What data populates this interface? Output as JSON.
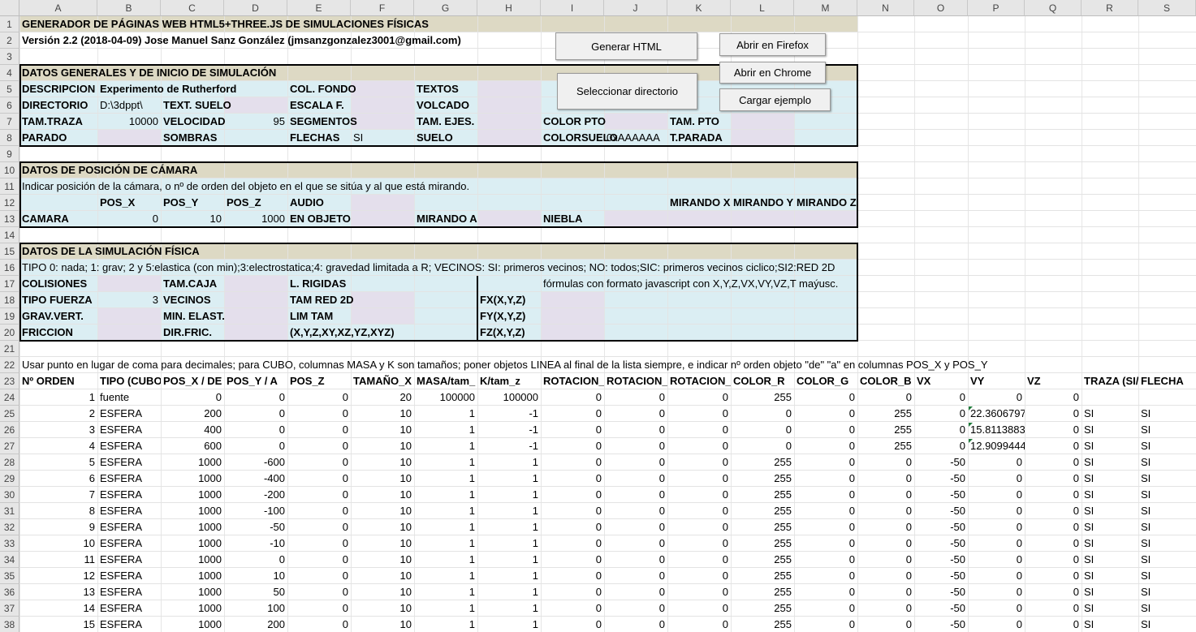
{
  "columns": [
    "A",
    "B",
    "C",
    "D",
    "E",
    "F",
    "G",
    "H",
    "I",
    "J",
    "K",
    "L",
    "M",
    "N",
    "O",
    "P",
    "Q",
    "R",
    "S"
  ],
  "rows": [
    "1",
    "2",
    "3",
    "4",
    "5",
    "6",
    "7",
    "8",
    "9",
    "10",
    "11",
    "12",
    "13",
    "14",
    "15",
    "16",
    "17",
    "18",
    "19",
    "20",
    "21",
    "22",
    "23",
    "24",
    "25",
    "26",
    "27",
    "28",
    "29",
    "30",
    "31",
    "32",
    "33",
    "34",
    "35",
    "36",
    "37",
    "38"
  ],
  "buttons": {
    "generate": "Generar HTML",
    "select_dir": "Seleccionar directorio",
    "firefox": "Abrir en Firefox",
    "chrome": "Abrir en Chrome",
    "load_example": "Cargar ejemplo"
  },
  "colors": {
    "header_band": "#ddd9c4",
    "section_bg": "#dbeef3",
    "input_cell": "#e4dfec"
  },
  "cells": [
    {
      "r": 1,
      "c": "A",
      "v": "GENERADOR DE PÁGINAS WEB HTML5+THREE.JS DE SIMULACIONES FÍSICAS",
      "b": 1
    },
    {
      "r": 2,
      "c": "A",
      "v": "Versión 2.2 (2018-04-09) Jose Manuel Sanz González (jmsanzgonzalez3001@gmail.com)",
      "b": 1
    },
    {
      "r": 4,
      "c": "A",
      "v": "DATOS GENERALES Y DE INICIO DE SIMULACIÓN",
      "b": 1
    },
    {
      "r": 5,
      "c": "A",
      "v": "DESCRIPCION",
      "b": 1
    },
    {
      "r": 5,
      "c": "B",
      "v": "Experimento de Rutherford",
      "b": 1
    },
    {
      "r": 5,
      "c": "E",
      "v": "COL. FONDO",
      "b": 1
    },
    {
      "r": 5,
      "c": "G",
      "v": "TEXTOS",
      "b": 1
    },
    {
      "r": 6,
      "c": "A",
      "v": "DIRECTORIO",
      "b": 1
    },
    {
      "r": 6,
      "c": "B",
      "v": "D:\\3dppt\\"
    },
    {
      "r": 6,
      "c": "C",
      "v": "TEXT. SUELO",
      "b": 1
    },
    {
      "r": 6,
      "c": "E",
      "v": "ESCALA F.",
      "b": 1
    },
    {
      "r": 6,
      "c": "G",
      "v": "VOLCADO",
      "b": 1
    },
    {
      "r": 7,
      "c": "A",
      "v": "TAM.TRAZA",
      "b": 1
    },
    {
      "r": 7,
      "c": "B",
      "v": "10000",
      "a": "r"
    },
    {
      "r": 7,
      "c": "C",
      "v": "VELOCIDAD",
      "b": 1
    },
    {
      "r": 7,
      "c": "D",
      "v": "95",
      "a": "r"
    },
    {
      "r": 7,
      "c": "E",
      "v": "SEGMENTOS",
      "b": 1
    },
    {
      "r": 7,
      "c": "G",
      "v": "TAM. EJES.",
      "b": 1
    },
    {
      "r": 7,
      "c": "I",
      "v": "COLOR PTO",
      "b": 1
    },
    {
      "r": 7,
      "c": "K",
      "v": "TAM. PTO",
      "b": 1
    },
    {
      "r": 8,
      "c": "A",
      "v": "PARADO",
      "b": 1
    },
    {
      "r": 8,
      "c": "C",
      "v": "SOMBRAS",
      "b": 1
    },
    {
      "r": 8,
      "c": "E",
      "v": "FLECHAS",
      "b": 1
    },
    {
      "r": 8,
      "c": "F",
      "v": "SI"
    },
    {
      "r": 8,
      "c": "G",
      "v": "SUELO",
      "b": 1
    },
    {
      "r": 8,
      "c": "I",
      "v": "COLORSUELO",
      "b": 1
    },
    {
      "r": 8,
      "c": "J",
      "v": "0xAAAAAA"
    },
    {
      "r": 8,
      "c": "K",
      "v": "T.PARADA",
      "b": 1
    },
    {
      "r": 10,
      "c": "A",
      "v": "DATOS DE POSICIÓN DE CÁMARA",
      "b": 1
    },
    {
      "r": 11,
      "c": "A",
      "v": "Indicar posición de la cámara, o nº de orden del objeto en el que se sitúa y al que está mirando."
    },
    {
      "r": 12,
      "c": "B",
      "v": "POS_X",
      "b": 1
    },
    {
      "r": 12,
      "c": "C",
      "v": "POS_Y",
      "b": 1
    },
    {
      "r": 12,
      "c": "D",
      "v": "POS_Z",
      "b": 1
    },
    {
      "r": 12,
      "c": "E",
      "v": "AUDIO",
      "b": 1
    },
    {
      "r": 12,
      "c": "K",
      "v": "MIRANDO X",
      "b": 1
    },
    {
      "r": 12,
      "c": "L",
      "v": "MIRANDO Y",
      "b": 1
    },
    {
      "r": 12,
      "c": "M",
      "v": "MIRANDO Z",
      "b": 1
    },
    {
      "r": 13,
      "c": "A",
      "v": "CAMARA",
      "b": 1
    },
    {
      "r": 13,
      "c": "B",
      "v": "0",
      "a": "r"
    },
    {
      "r": 13,
      "c": "C",
      "v": "10",
      "a": "r"
    },
    {
      "r": 13,
      "c": "D",
      "v": "1000",
      "a": "r"
    },
    {
      "r": 13,
      "c": "E",
      "v": "EN OBJETO",
      "b": 1
    },
    {
      "r": 13,
      "c": "G",
      "v": "MIRANDO A",
      "b": 1
    },
    {
      "r": 13,
      "c": "I",
      "v": "NIEBLA",
      "b": 1
    },
    {
      "r": 15,
      "c": "A",
      "v": "DATOS DE LA SIMULACIÓN FÍSICA",
      "b": 1
    },
    {
      "r": 16,
      "c": "A",
      "v": "TIPO 0: nada; 1: grav; 2 y 5:elastica (con min);3:electrostatica;4: gravedad limitada a R; VECINOS: SI: primeros vecinos; NO: todos;SIC: primeros vecinos ciclico;SI2:RED 2D"
    },
    {
      "r": 17,
      "c": "A",
      "v": "COLISIONES",
      "b": 1
    },
    {
      "r": 17,
      "c": "C",
      "v": "TAM.CAJA",
      "b": 1
    },
    {
      "r": 17,
      "c": "E",
      "v": "L. RIGIDAS",
      "b": 1
    },
    {
      "r": 17,
      "c": "I",
      "v": "fórmulas con formato javascript con X,Y,Z,VX,VY,VZ,T maýusc."
    },
    {
      "r": 18,
      "c": "A",
      "v": "TIPO FUERZA",
      "b": 1
    },
    {
      "r": 18,
      "c": "B",
      "v": "3",
      "a": "r"
    },
    {
      "r": 18,
      "c": "C",
      "v": "VECINOS",
      "b": 1
    },
    {
      "r": 18,
      "c": "E",
      "v": "TAM RED 2D",
      "b": 1
    },
    {
      "r": 18,
      "c": "H",
      "v": "FX(X,Y,Z)",
      "b": 1
    },
    {
      "r": 19,
      "c": "A",
      "v": "GRAV.VERT.",
      "b": 1
    },
    {
      "r": 19,
      "c": "C",
      "v": "MIN. ELAST.",
      "b": 1
    },
    {
      "r": 19,
      "c": "E",
      "v": "LIM TAM",
      "b": 1
    },
    {
      "r": 19,
      "c": "H",
      "v": "FY(X,Y,Z)",
      "b": 1
    },
    {
      "r": 20,
      "c": "A",
      "v": "FRICCION",
      "b": 1
    },
    {
      "r": 20,
      "c": "C",
      "v": "DIR.FRIC.",
      "b": 1
    },
    {
      "r": 20,
      "c": "E",
      "v": "(X,Y,Z,XY,XZ,YZ,XYZ)",
      "b": 1
    },
    {
      "r": 20,
      "c": "H",
      "v": "FZ(X,Y,Z)",
      "b": 1
    },
    {
      "r": 22,
      "c": "A",
      "v": "Usar punto en lugar de coma para decimales; para CUBO, columnas MASA y K son tamaños; poner objetos LINEA al final de la lista siempre, e indicar nº orden objeto \"de\" \"a\" en columnas POS_X y POS_Y"
    }
  ],
  "table_headers": [
    "Nº ORDEN",
    "TIPO (CUBO,",
    "POS_X / DE",
    "POS_Y / A",
    "POS_Z",
    "TAMAÑO_X",
    "MASA/tam_",
    "K/tam_z",
    "ROTACION_",
    "ROTACION_",
    "ROTACION_",
    "COLOR_R",
    "COLOR_G",
    "COLOR_B",
    "VX",
    "VY",
    "VZ",
    "TRAZA (SI/",
    "FLECHA"
  ],
  "table_rows": [
    [
      "1",
      "fuente",
      "0",
      "0",
      "0",
      "20",
      "100000",
      "100000",
      "0",
      "0",
      "0",
      "255",
      "0",
      "0",
      "0",
      "0",
      "0",
      "",
      ""
    ],
    [
      "2",
      "ESFERA",
      "200",
      "0",
      "0",
      "10",
      "1",
      "-1",
      "0",
      "0",
      "0",
      "0",
      "0",
      "255",
      "0",
      "22.3606797",
      "0",
      "SI",
      "SI"
    ],
    [
      "3",
      "ESFERA",
      "400",
      "0",
      "0",
      "10",
      "1",
      "-1",
      "0",
      "0",
      "0",
      "0",
      "0",
      "255",
      "0",
      "15.8113883",
      "0",
      "SI",
      "SI"
    ],
    [
      "4",
      "ESFERA",
      "600",
      "0",
      "0",
      "10",
      "1",
      "-1",
      "0",
      "0",
      "0",
      "0",
      "0",
      "255",
      "0",
      "12.9099444",
      "0",
      "SI",
      "SI"
    ],
    [
      "5",
      "ESFERA",
      "1000",
      "-600",
      "0",
      "10",
      "1",
      "1",
      "0",
      "0",
      "0",
      "255",
      "0",
      "0",
      "-50",
      "0",
      "0",
      "SI",
      "SI"
    ],
    [
      "6",
      "ESFERA",
      "1000",
      "-400",
      "0",
      "10",
      "1",
      "1",
      "0",
      "0",
      "0",
      "255",
      "0",
      "0",
      "-50",
      "0",
      "0",
      "SI",
      "SI"
    ],
    [
      "7",
      "ESFERA",
      "1000",
      "-200",
      "0",
      "10",
      "1",
      "1",
      "0",
      "0",
      "0",
      "255",
      "0",
      "0",
      "-50",
      "0",
      "0",
      "SI",
      "SI"
    ],
    [
      "8",
      "ESFERA",
      "1000",
      "-100",
      "0",
      "10",
      "1",
      "1",
      "0",
      "0",
      "0",
      "255",
      "0",
      "0",
      "-50",
      "0",
      "0",
      "SI",
      "SI"
    ],
    [
      "9",
      "ESFERA",
      "1000",
      "-50",
      "0",
      "10",
      "1",
      "1",
      "0",
      "0",
      "0",
      "255",
      "0",
      "0",
      "-50",
      "0",
      "0",
      "SI",
      "SI"
    ],
    [
      "10",
      "ESFERA",
      "1000",
      "-10",
      "0",
      "10",
      "1",
      "1",
      "0",
      "0",
      "0",
      "255",
      "0",
      "0",
      "-50",
      "0",
      "0",
      "SI",
      "SI"
    ],
    [
      "11",
      "ESFERA",
      "1000",
      "0",
      "0",
      "10",
      "1",
      "1",
      "0",
      "0",
      "0",
      "255",
      "0",
      "0",
      "-50",
      "0",
      "0",
      "SI",
      "SI"
    ],
    [
      "12",
      "ESFERA",
      "1000",
      "10",
      "0",
      "10",
      "1",
      "1",
      "0",
      "0",
      "0",
      "255",
      "0",
      "0",
      "-50",
      "0",
      "0",
      "SI",
      "SI"
    ],
    [
      "13",
      "ESFERA",
      "1000",
      "50",
      "0",
      "10",
      "1",
      "1",
      "0",
      "0",
      "0",
      "255",
      "0",
      "0",
      "-50",
      "0",
      "0",
      "SI",
      "SI"
    ],
    [
      "14",
      "ESFERA",
      "1000",
      "100",
      "0",
      "10",
      "1",
      "1",
      "0",
      "0",
      "0",
      "255",
      "0",
      "0",
      "-50",
      "0",
      "0",
      "SI",
      "SI"
    ],
    [
      "15",
      "ESFERA",
      "1000",
      "200",
      "0",
      "10",
      "1",
      "1",
      "0",
      "0",
      "0",
      "255",
      "0",
      "0",
      "-50",
      "0",
      "0",
      "SI",
      "SI"
    ]
  ]
}
